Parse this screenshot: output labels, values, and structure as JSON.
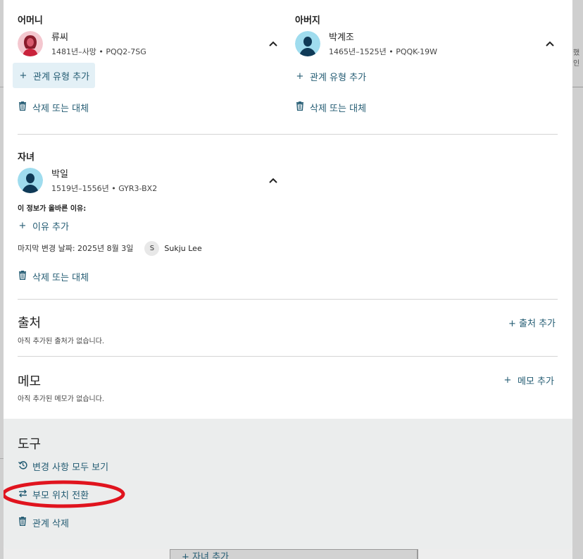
{
  "background": {
    "right_text": "했인",
    "bottom_add_child": "+ 자녀 추가"
  },
  "mother": {
    "role": "어머니",
    "name": "류씨",
    "meta": "1481년–사망 • PQQ2-7SG",
    "add_relationship": "관계 유형 추가",
    "delete_replace": "삭제 또는 대체"
  },
  "father": {
    "role": "아버지",
    "name": "박계조",
    "meta": "1465년–1525년 • PQQK-19W",
    "add_relationship": "관계 유형 추가",
    "delete_replace": "삭제 또는 대체"
  },
  "child": {
    "role": "자녀",
    "name": "박일",
    "meta": "1519년–1556년 • GYR3-BX2",
    "reason_label": "이 정보가 올바른 이유:",
    "add_reason": "이유 추가",
    "last_modified": "마지막 변경 날짜: 2025년 8월 3일",
    "user_initial": "S",
    "user_name": "Sukju Lee",
    "delete_replace": "삭제 또는 대체"
  },
  "sources": {
    "title": "출처",
    "empty": "아직 추가된 출처가 없습니다.",
    "add": "+ 출처 추가"
  },
  "notes": {
    "title": "메모",
    "empty": "아직 추가된 메모가 없습니다.",
    "add": "메모 추가"
  },
  "tools": {
    "title": "도구",
    "view_all_changes": "변경 사항 모두 보기",
    "swap_parents": "부모 위치 전환",
    "delete_relationship": "관계 삭제"
  },
  "colors": {
    "link": "#245c73",
    "highlight_bg": "#e3f0f6",
    "tools_bg": "#ebeded",
    "annotation": "#e0141e"
  },
  "icons": {
    "plus": "plus-icon",
    "trash": "trash-icon",
    "chevron": "chevron-up-icon",
    "history": "history-icon",
    "swap": "swap-icon"
  }
}
